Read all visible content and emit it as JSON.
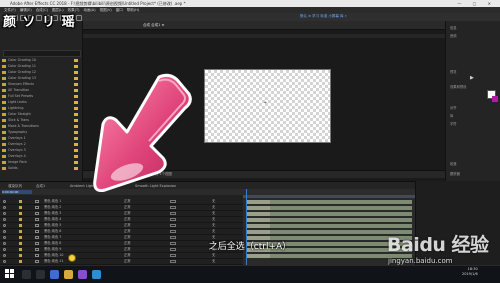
{
  "window": {
    "title": "Adobe After Effects CC 2018 - F:\\视频剪辑\\bilibili\\原创视频\\Untitled Project* (已修改) .aep *",
    "controls": "—  ▢  ✕"
  },
  "menu": [
    "文件(F)",
    "编辑(E)",
    "合成(C)",
    "图层(L)",
    "效果(T)",
    "动画(A)",
    "视图(V)",
    "窗口",
    "帮助(H)"
  ],
  "toolbar": {
    "workspace_label": "默认 ≡  学习  标准  小屏幕  库  »"
  },
  "project_panel": {
    "logo_text": "颜 ソ リ 瑶",
    "items": [
      "Color Grading 10",
      "Color Grading 11",
      "Color Grading 12",
      "Color Grading 13",
      "Sharpen Effects",
      "AE Transition",
      "Full Set Presets",
      "Light Leaks",
      "Lightning",
      "Color Straight",
      "Slick & Trans",
      "Mask & Transitions",
      "Typography",
      "Overlays 1",
      "Overlays 2",
      "Overlays 3",
      "Overlays 4",
      "Image Pack",
      "Solids"
    ]
  },
  "viewer": {
    "tab_label": "合成 合成1 ≡",
    "bottom_bar": "50%  ▢  0:00:00:00  完整  活动摄像机  1个视图"
  },
  "right_panel": {
    "labels": [
      "信息",
      "音频",
      "预览",
      "效果和预设",
      "对齐",
      "库",
      "字符",
      "段落",
      "跟踪器"
    ],
    "play_symbol": "▶"
  },
  "timeline": {
    "tabs": [
      "渲染队列",
      "合成1",
      "Ambient Light Explosion",
      "Smooth Light Explosion"
    ],
    "comp_name": "0:00:00:00",
    "layers": [
      {
        "name": "黑色 纯色 1",
        "mode": "正常",
        "parent": "无"
      },
      {
        "name": "黑色 纯色 2",
        "mode": "正常",
        "parent": "无"
      },
      {
        "name": "黑色 纯色 3",
        "mode": "正常",
        "parent": "无"
      },
      {
        "name": "黑色 纯色 4",
        "mode": "正常",
        "parent": "无"
      },
      {
        "name": "黑色 纯色 5",
        "mode": "正常",
        "parent": "无"
      },
      {
        "name": "黑色 纯色 6",
        "mode": "正常",
        "parent": "无"
      },
      {
        "name": "黑色 纯色 7",
        "mode": "正常",
        "parent": "无"
      },
      {
        "name": "黑色 纯色 8",
        "mode": "正常",
        "parent": "无"
      },
      {
        "name": "黑色 纯色 9",
        "mode": "正常",
        "parent": "无"
      },
      {
        "name": "黑色 纯色 10",
        "mode": "正常",
        "parent": "无"
      },
      {
        "name": "黑色 纯色 11",
        "mode": "正常",
        "parent": "无"
      },
      {
        "name": "黑色 纯色 12",
        "mode": "正常",
        "parent": "无"
      }
    ]
  },
  "caption": "之后全选（ctrl+A）",
  "watermark": {
    "brand": "Baidu 经验",
    "url": "jingyan.baidu.com"
  },
  "taskbar": {
    "time": "18:30",
    "date": "2019/1/6"
  },
  "colors": {
    "arrow_pink": "#e0457a",
    "selection_blue": "#3a7bd5",
    "swatch": "#b41ca0"
  }
}
